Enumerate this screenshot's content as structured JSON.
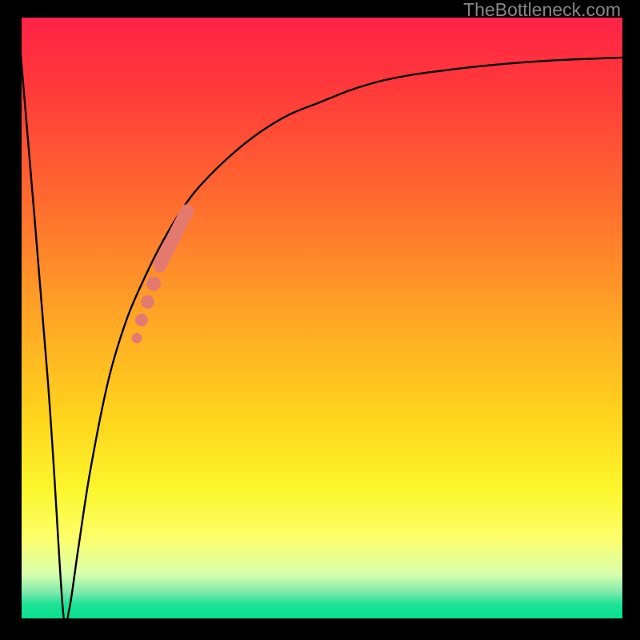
{
  "watermark": "TheBottleneck.com",
  "colors": {
    "curve": "#000000",
    "dots": "#e47a6f",
    "frame": "#000000"
  },
  "chart_data": {
    "type": "line",
    "title": "",
    "xlabel": "",
    "ylabel": "",
    "xlim": [
      0,
      100
    ],
    "ylim": [
      0,
      100
    ],
    "grid": false,
    "legend": false,
    "curve_description": "Sharp V-dip near x≈8 then asymptotic rise toward y≈93",
    "curve_x": [
      0,
      5,
      7.5,
      8.5,
      10,
      12,
      15,
      18,
      21,
      24,
      27,
      30,
      35,
      40,
      45,
      50,
      55,
      60,
      65,
      70,
      75,
      80,
      85,
      90,
      95,
      100
    ],
    "curve_y": [
      100,
      40,
      2,
      2,
      12,
      25,
      40,
      50,
      57,
      63,
      68,
      72,
      77,
      81,
      84,
      86,
      88,
      89.5,
      90.5,
      91.2,
      91.8,
      92.3,
      92.7,
      93.0,
      93.2,
      93.4
    ],
    "overlay_points": {
      "description": "Highlighted samples on rising edge of curve",
      "x": [
        19.7,
        20.5,
        21.5,
        22.5,
        23.5,
        24.5,
        25,
        26,
        27,
        28
      ],
      "y": [
        47,
        50,
        53,
        56,
        59,
        61,
        62,
        64,
        66,
        68
      ]
    }
  }
}
